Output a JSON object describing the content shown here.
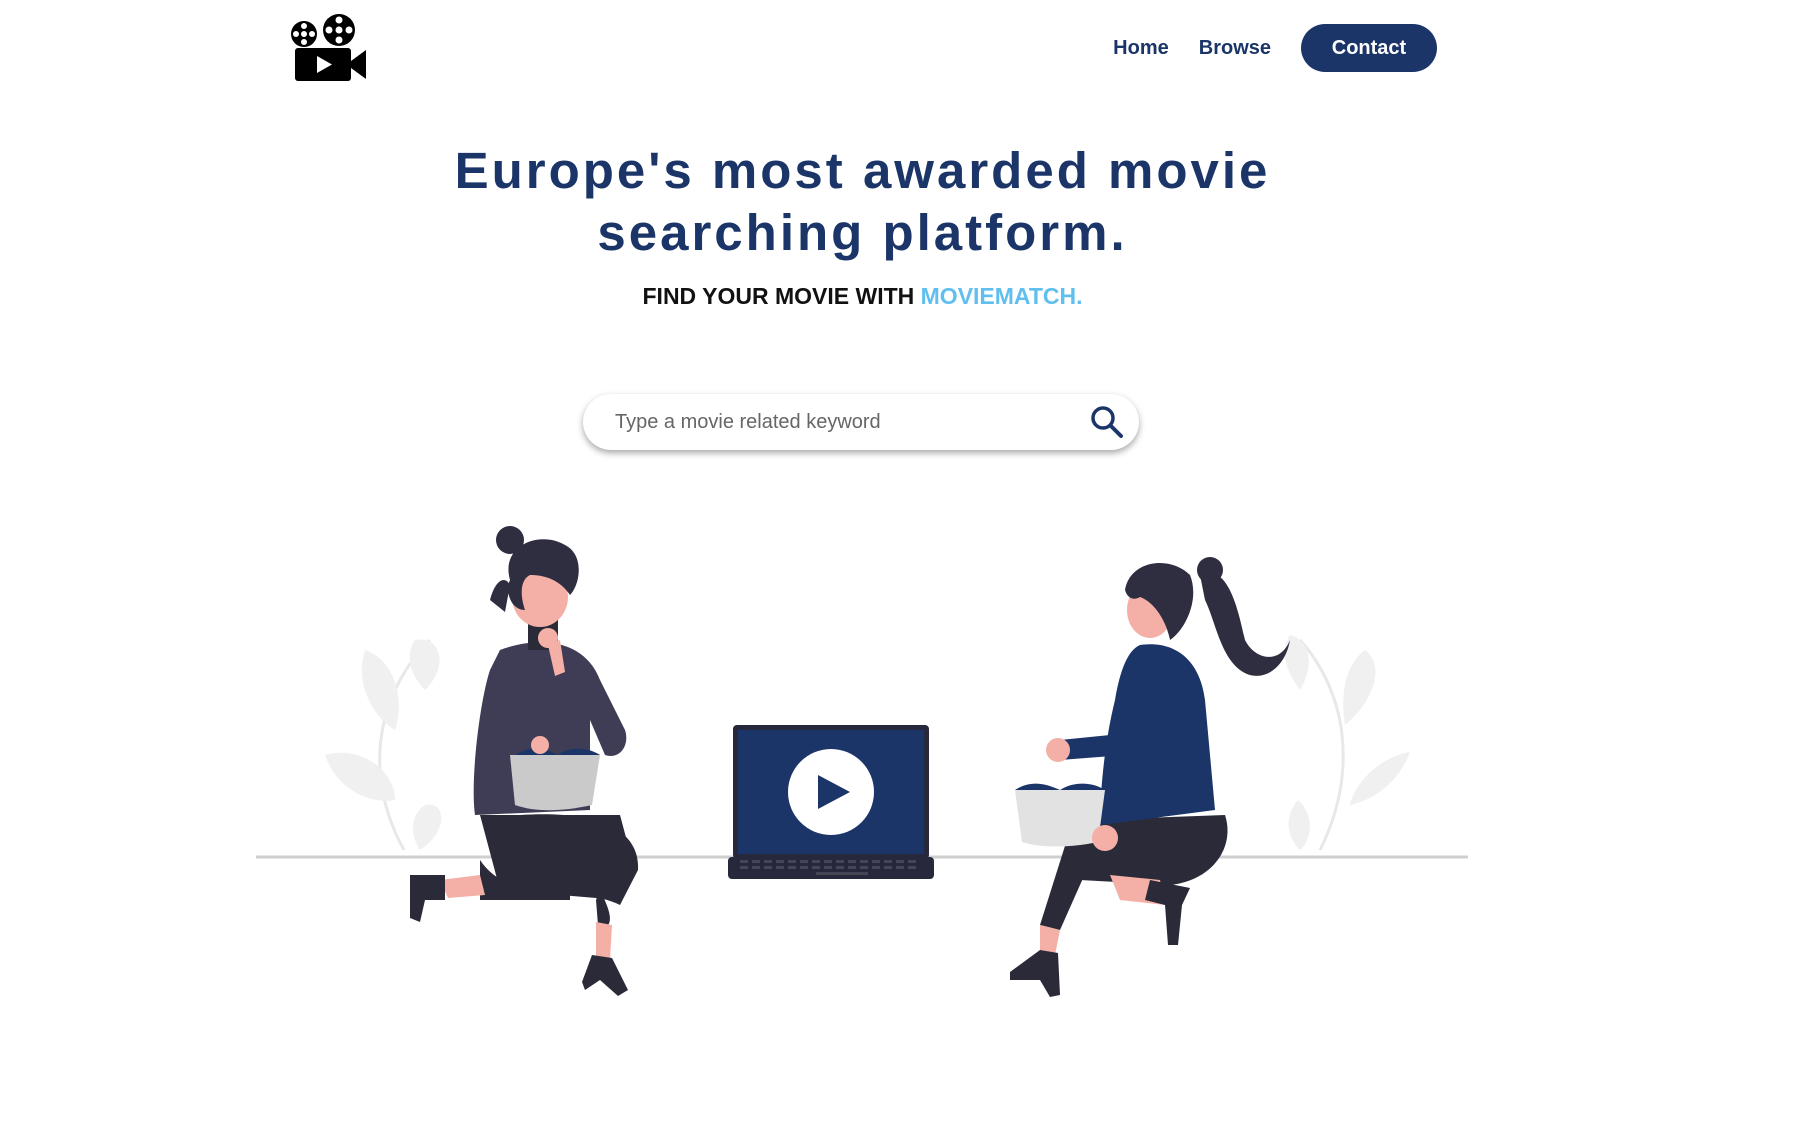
{
  "header": {
    "logo_icon": "movie-camera-icon",
    "nav": {
      "home": "Home",
      "browse": "Browse",
      "contact": "Contact"
    }
  },
  "hero": {
    "title_line1": "Europe's most awarded movie",
    "title_line2": "searching platform.",
    "subtitle_prefix": "FIND YOUR MOVIE WITH",
    "subtitle_brand": "MOVIEMATCH."
  },
  "search": {
    "placeholder": "Type a movie related keyword",
    "value": "",
    "icon": "search-icon"
  },
  "illustration": {
    "icon": "people-watching-movie-illustration"
  },
  "colors": {
    "primary": "#1b3568",
    "accent": "#5fbfee",
    "text_dark": "#111111",
    "background": "#ffffff"
  }
}
